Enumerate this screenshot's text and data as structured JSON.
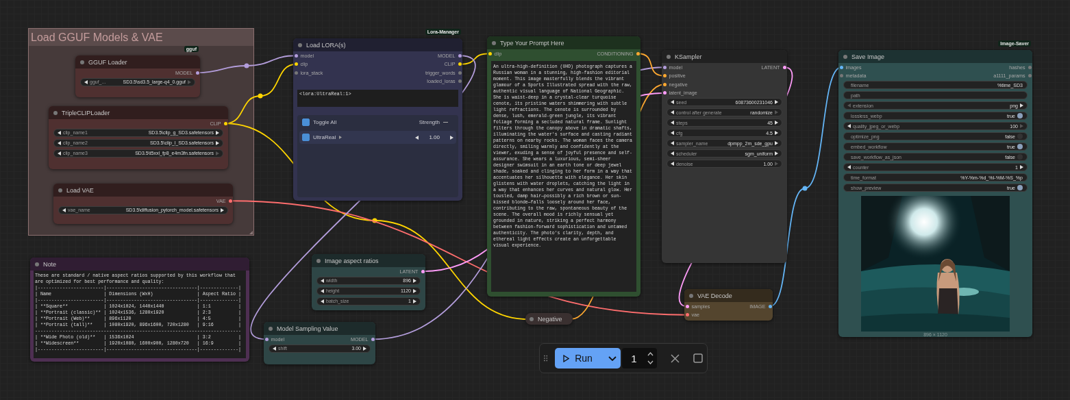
{
  "group": {
    "title": "Load GGUF Models & VAE",
    "color": "#463a3a"
  },
  "nodes": [
    {
      "kind": "node",
      "title": "GGUF Loader",
      "color": "#4f3030",
      "badge": "gguf",
      "outputs": [
        {
          "name": "MODEL",
          "color": "#b39ddb"
        }
      ],
      "widgets": [
        {
          "kind": "combo",
          "label": "gguf_...",
          "value": "SD3.5\\sd3.5_large-q4_0.gguf",
          "prev_disabled": false,
          "next_disabled": true
        }
      ]
    },
    {
      "kind": "node",
      "title": "TripleCLIPLoader",
      "color": "#4f3030",
      "outputs": [
        {
          "name": "CLIP",
          "color": "#ffd500"
        }
      ],
      "widgets": [
        {
          "kind": "combo",
          "label": "clip_name1",
          "value": "SD3.5\\clip_g_SD3.safetensors",
          "prev_disabled": false,
          "next_disabled": false
        },
        {
          "kind": "combo",
          "label": "clip_name2",
          "value": "SD3.5\\clip_l_SD3.safetensors",
          "prev_disabled": false,
          "next_disabled": false
        },
        {
          "kind": "combo",
          "label": "clip_name3",
          "value": "SD3.5\\t5xxl_fp8_e4m3fn.safetensors",
          "prev_disabled": false,
          "next_disabled": true
        }
      ]
    },
    {
      "kind": "node",
      "title": "Load VAE",
      "color": "#4f3030",
      "outputs": [
        {
          "name": "VAE",
          "color": "#ff6e6e"
        }
      ],
      "widgets": [
        {
          "kind": "combo",
          "label": "vae_name",
          "value": "SD3.5\\diffusion_pytorch_model.safetensors",
          "prev_disabled": false,
          "next_disabled": false
        }
      ]
    },
    {
      "kind": "lora",
      "title": "Load LORA(s)",
      "color": "#33334f",
      "badge": "Lora-Manager",
      "inputs": [
        {
          "name": "model",
          "color": "#b39ddb"
        },
        {
          "name": "clip",
          "color": "#ffd500"
        },
        {
          "name": "lora_stack",
          "color": "#777777"
        }
      ],
      "outputs": [
        {
          "name": "MODEL",
          "color": "#b39ddb"
        },
        {
          "name": "CLIP",
          "color": "#ffd500"
        },
        {
          "name": "trigger_words",
          "color": "#777777"
        },
        {
          "name": "loaded_loras",
          "color": "#777777"
        }
      ],
      "text": "<lora:UltraReal:1>",
      "lora_list": {
        "toggle_all": {
          "label": "Toggle All",
          "checked": true
        },
        "strength_label": "Strength",
        "loras": [
          {
            "name": "UltraReal",
            "checked": true,
            "strength": "1.00"
          }
        ]
      }
    },
    {
      "kind": "prompt",
      "title": "Type Your Prompt Here",
      "color": "#2f4f30",
      "inputs": [
        {
          "name": "clip",
          "color": "#ffd500"
        }
      ],
      "outputs": [
        {
          "name": "CONDITIONING",
          "color": "#ffa931"
        }
      ],
      "text": "An ultra-high-definition (UHD) photograph captures a Russian woman in a stunning, high-fashion editorial moment. This image masterfully blends the vibrant glamour of a Sports Illustrated spread with the raw, authentic visual language of National Geographic. She is waist-deep in a crystal-clear turquoise cenote, its pristine waters shimmering with subtle light refractions. The cenote is surrounded by dense, lush, emerald-green jungle, its vibrant foliage forming a secluded natural frame. Sunlight filters through the canopy above in dramatic shafts, illuminating the water's surface and casting radiant patterns on nearby rocks. The woman faces the camera directly, smiling warmly and confidently at the viewer, exuding a sense of joyful presence and self-assurance. She wears a luxurious, semi-sheer designer swimsuit in an earth tone or deep jewel shade, soaked and clinging to her form in a way that accentuates her silhouette with elegance. Her skin glistens with water droplets, catching the light in a way that enhances her curves and natural glow. Her tousled, damp hair—possibly a rich brown or sun-kissed blonde—falls loosely around her face, contributing to the raw, spontaneous beauty of the scene. The overall mood is richly sensual yet grounded in nature, striking a perfect harmony between fashion-forward sophistication and untamed authenticity. The photo's clarity, depth, and ethereal light effects create an unforgettable visual experience."
    },
    {
      "kind": "node",
      "title": "KSampler",
      "color": "#353535",
      "inputs": [
        {
          "name": "model",
          "color": "#b39ddb"
        },
        {
          "name": "positive",
          "color": "#ffa931"
        },
        {
          "name": "negative",
          "color": "#ffa931"
        },
        {
          "name": "latent_image",
          "color": "#ff9cf9"
        }
      ],
      "outputs": [
        {
          "name": "LATENT",
          "color": "#ff9cf9"
        }
      ],
      "widgets": [
        {
          "kind": "number",
          "label": "seed",
          "value": "60873600231046",
          "prev_disabled": false,
          "next_disabled": false
        },
        {
          "kind": "combo",
          "label": "control after generate",
          "value": "randomize",
          "prev_disabled": false,
          "next_disabled": true
        },
        {
          "kind": "number",
          "label": "steps",
          "value": "45",
          "prev_disabled": false,
          "next_disabled": false
        },
        {
          "kind": "number",
          "label": "cfg",
          "value": "4.5",
          "prev_disabled": false,
          "next_disabled": false
        },
        {
          "kind": "combo",
          "label": "sampler_name",
          "value": "dpmpp_2m_sde_gpu",
          "prev_disabled": false,
          "next_disabled": false
        },
        {
          "kind": "combo",
          "label": "scheduler",
          "value": "sgm_uniform",
          "prev_disabled": false,
          "next_disabled": false
        },
        {
          "kind": "number",
          "label": "denoise",
          "value": "1.00",
          "prev_disabled": false,
          "next_disabled": true
        }
      ]
    },
    {
      "kind": "save",
      "title": "Save Image",
      "color": "#2f5050",
      "badge": "Image-Saver",
      "inputs": [
        {
          "name": "images",
          "color": "#64b5f6"
        },
        {
          "name": "metadata",
          "color": "#777777"
        }
      ],
      "outputs": [
        {
          "name": "hashes",
          "color": "#777777"
        },
        {
          "name": "a1111_params",
          "color": "#777777"
        }
      ],
      "widgets": [
        {
          "kind": "text",
          "label": "filename",
          "value": "%time_SD3"
        },
        {
          "kind": "text",
          "label": "path"
        },
        {
          "kind": "combo",
          "label": "extension",
          "value": "png",
          "prev_disabled": true,
          "next_disabled": false
        },
        {
          "kind": "toggle",
          "label": "lossless_webp",
          "value": "true",
          "on": true
        },
        {
          "kind": "number",
          "label": "quality_jpeg_or_webp",
          "value": "100",
          "prev_disabled": false,
          "next_disabled": true
        },
        {
          "kind": "toggle",
          "label": "optimize_png",
          "value": "false",
          "on": false
        },
        {
          "kind": "toggle",
          "label": "embed_workflow",
          "value": "true",
          "on": true
        },
        {
          "kind": "toggle",
          "label": "save_workflow_as_json",
          "value": "false",
          "on": false
        },
        {
          "kind": "number",
          "label": "counter",
          "value": "1",
          "prev_disabled": false,
          "next_disabled": false
        },
        {
          "kind": "text",
          "label": "time_format",
          "value": "%Y-%m-%d_%I-%M-%S_%p"
        },
        {
          "kind": "toggle",
          "label": "show_preview",
          "value": "true",
          "on": true
        }
      ],
      "preview": {
        "kind": "picture",
        "caption": "896 × 1120"
      }
    },
    {
      "kind": "note",
      "title": "Note",
      "color": "#4e2f52",
      "lines": [
        "These are standard / native aspect ratios supported by this workflow that are optimized for best performance and quality:",
        "|------------------------|---------------------------------|--------------|",
        "| Name                   | Dimensions (WxH)                | Aspect Ratio |",
        "|------------------------|---------------------------------|--------------|",
        "| **Square**             | 1024x1024, 1440x1440            | 1:1          |",
        "| **Portrait (classic)** | 1024x1536, 1280x1920            | 2:3          |",
        "| **Portrait (Web)**     | 896x1120                        | 4:5          |",
        "| **Portrait (tall)**    | 1080x1920, 896x1600, 720x1280   | 9:16         |",
        "---------------------------------------------------------------------------",
        "| **Wide Photo (old)**   | 1536x1024                       | 3:2          |",
        "| **Widescreen**         | 1920x1080, 1600x900, 1280x720   | 16:9         |",
        "|------------------------|---------------------------------|--------------|"
      ]
    },
    {
      "kind": "node",
      "title": "Image aspect ratios",
      "color": "#2e4646",
      "outputs": [
        {
          "name": "LATENT",
          "color": "#ff9cf9"
        }
      ],
      "widgets": [
        {
          "kind": "number",
          "label": "width",
          "value": "896",
          "prev_disabled": false,
          "next_disabled": false
        },
        {
          "kind": "number",
          "label": "height",
          "value": "1120",
          "prev_disabled": false,
          "next_disabled": false
        },
        {
          "kind": "number",
          "label": "batch_size",
          "value": "1",
          "prev_disabled": false,
          "next_disabled": false
        }
      ]
    },
    {
      "kind": "node",
      "title": "Model Sampling Value",
      "color": "#2e4646",
      "inputs": [
        {
          "name": "model",
          "color": "#b39ddb"
        }
      ],
      "outputs": [
        {
          "name": "MODEL",
          "color": "#b39ddb"
        }
      ],
      "widgets": [
        {
          "kind": "number",
          "label": "shift",
          "value": "3.00",
          "prev_disabled": false,
          "next_disabled": false
        }
      ]
    },
    {
      "kind": "node",
      "title": "VAE Decode",
      "color": "#54452e",
      "inputs": [
        {
          "name": "samples",
          "color": "#ff9cf9"
        },
        {
          "name": "vae",
          "color": "#ff6e6e"
        }
      ],
      "outputs": [
        {
          "name": "IMAGE",
          "color": "#64b5f6"
        }
      ]
    },
    {
      "kind": "collapsed",
      "title": "Negative",
      "color": "#3a3030"
    }
  ],
  "toolbar": {
    "run_label": "Run",
    "queue_count": "1"
  }
}
